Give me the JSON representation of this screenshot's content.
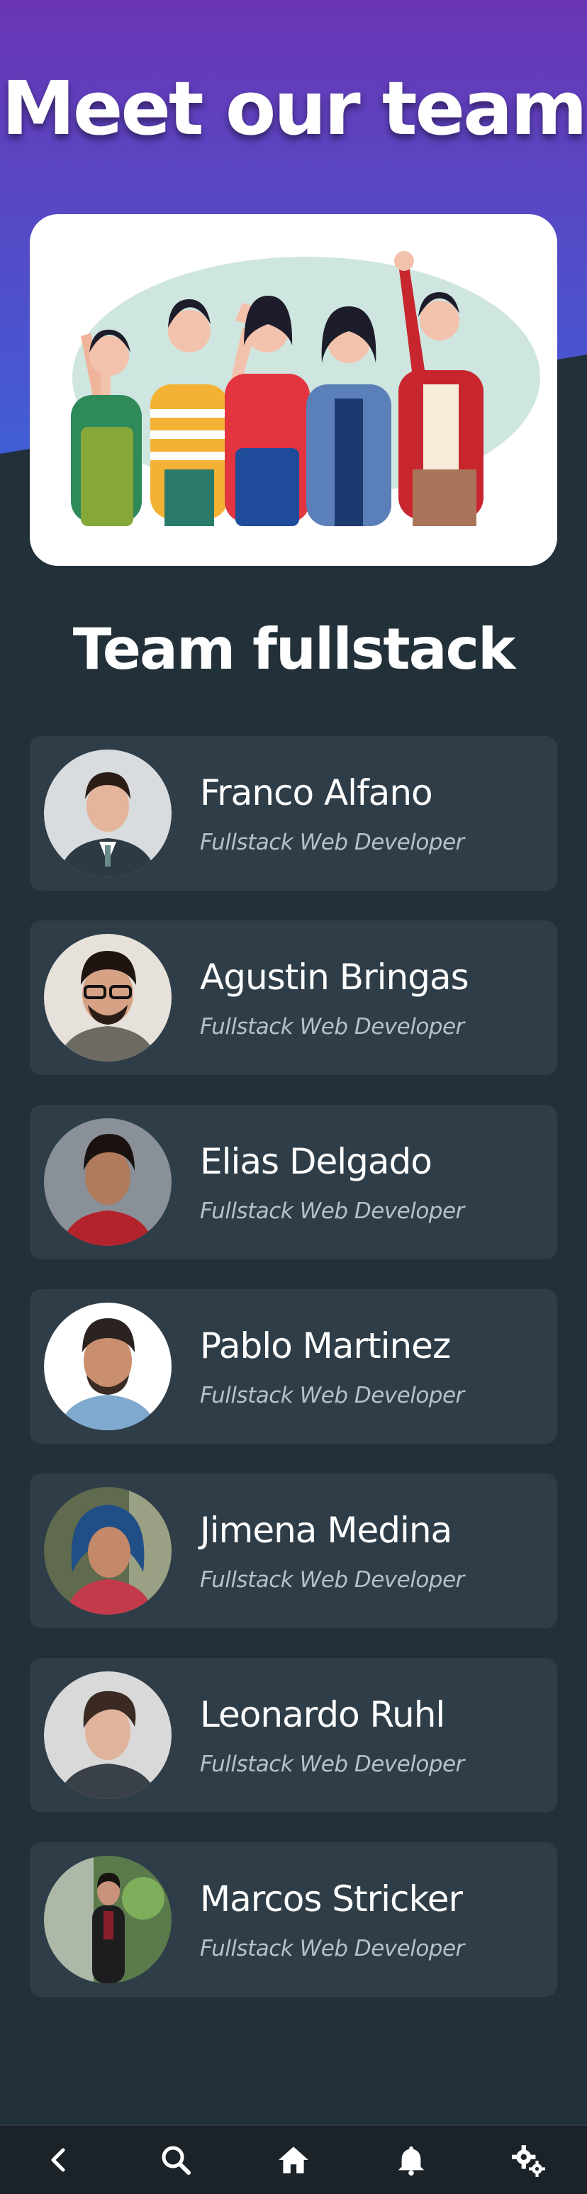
{
  "header": {
    "title": "Meet our team"
  },
  "section": {
    "title": "Team fullstack"
  },
  "members": [
    {
      "name": "Franco Alfano",
      "role": "Fullstack Web Developer"
    },
    {
      "name": "Agustin Bringas",
      "role": "Fullstack Web Developer"
    },
    {
      "name": "Elias Delgado",
      "role": "Fullstack Web Developer"
    },
    {
      "name": "Pablo Martinez",
      "role": "Fullstack Web Developer"
    },
    {
      "name": "Jimena Medina",
      "role": "Fullstack Web Developer"
    },
    {
      "name": "Leonardo Ruhl",
      "role": "Fullstack Web Developer"
    },
    {
      "name": "Marcos Stricker",
      "role": "Fullstack Web Developer"
    }
  ],
  "bottom_nav": {
    "items": [
      "back-icon",
      "search-icon",
      "home-icon",
      "bell-icon",
      "settings-icon"
    ]
  },
  "colors": {
    "background": "#22303a",
    "card": "#2e3d47",
    "hero_gradient_top": "#6a36b5",
    "hero_gradient_bottom": "#3a62d6",
    "nav": "#1b2329"
  }
}
